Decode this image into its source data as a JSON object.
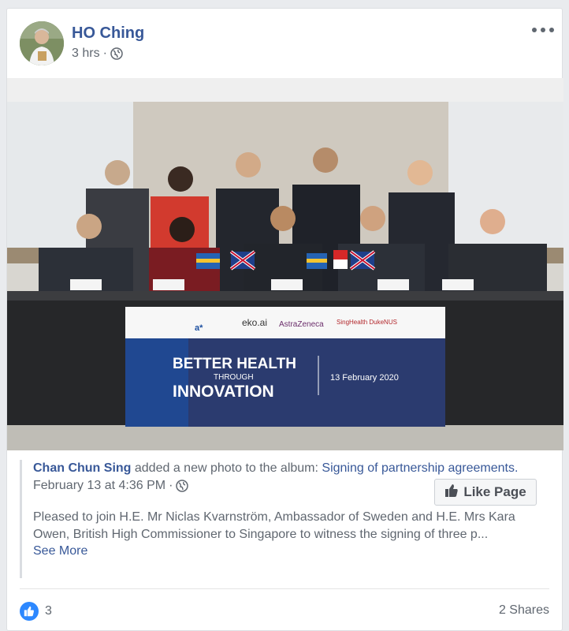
{
  "post": {
    "author": "HO Ching",
    "time": "3 hrs",
    "separator": "·"
  },
  "photo": {
    "banner_title_1": "BETTER HEALTH",
    "banner_title_2": "THROUGH",
    "banner_title_3": "INNOVATION",
    "banner_date": "13 February 2020",
    "logo_eko": "eko.ai",
    "logo_az": "AstraZeneca",
    "logo_singhealth": "SingHealth DukeNUS"
  },
  "shared": {
    "author": "Chan Chun Sing",
    "action": " added a new photo to the album: ",
    "album": "Signing of partnership agreements.",
    "date": "February 13 at 4:36 PM",
    "separator": "·",
    "like_page_label": "Like Page",
    "text": "Pleased to join H.E. Mr Niclas Kvarnström, Ambassador of Sweden and H.E. Mrs Kara Owen, British High Commissioner to Singapore to witness the signing of three p...",
    "see_more": "See More"
  },
  "footer": {
    "like_count": "3",
    "shares": "2 Shares"
  },
  "colors": {
    "link": "#385898",
    "like_blue": "#2d88ff",
    "meta_gray": "#606770"
  },
  "icons": {
    "audience": "globe-icon",
    "like": "thumbs-up-icon",
    "menu": "more-dots-icon"
  }
}
